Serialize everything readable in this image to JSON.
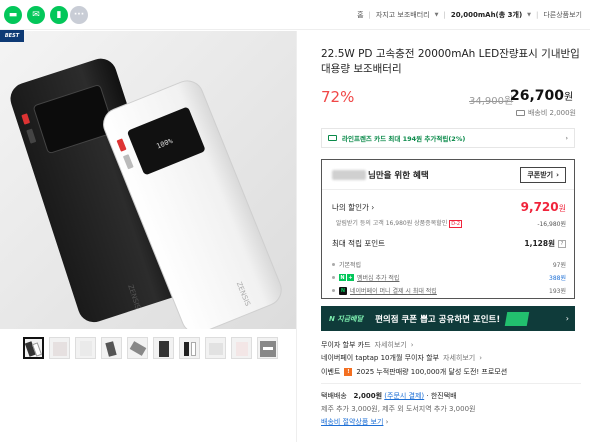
{
  "topbar": {
    "share_icons": [
      "talk-talk-icon",
      "talk-icon",
      "bookmark-icon",
      "more-icon"
    ],
    "crumbs": {
      "home": "홈",
      "category": "자지고 보조배터리",
      "option": "20,000mAh(총 3개)",
      "more": "다른상품보기"
    }
  },
  "image": {
    "badge": "BEST",
    "thumb_count": 10
  },
  "product": {
    "title": "22.5W PD 고속충전 20000mAh LED잔량표시 기내반입 대용량 보조배터리",
    "discount": "72%",
    "original_price": "34,900원",
    "price_number": "26,700",
    "price_unit": "원",
    "shipping": "배송비 2,000원"
  },
  "card_promo": "라인프렌즈 카드 최대 194원 추가적립(2%)",
  "benefit": {
    "title": "님만을 위한 혜택",
    "coupon_button": "쿠폰받기",
    "my_price_label": "나의 할인가",
    "my_price_number": "9,720",
    "my_price_unit": "원",
    "sub_text": "알림받기 등의 고객 16,980원 상품증복할인",
    "sub_tag": "D-2",
    "sub_value": "-16,980원",
    "points_label": "최대 적립 포인트",
    "points_value": "1,128원",
    "points_help": "?",
    "items": [
      {
        "label": "기본적립",
        "value": "97원",
        "badge": "",
        "link": false,
        "blue": false
      },
      {
        "label": "멤버십 추가 적립",
        "value": "388원",
        "badge": "N+",
        "link": true,
        "blue": true
      },
      {
        "label": "네이버페이 머니 결제 시 최대 적립",
        "value": "193원",
        "badge": "N",
        "link": true,
        "blue": false
      }
    ]
  },
  "banner": {
    "logo": "N 지금배달",
    "text": "편의점 쿠폰 뽑고 공유하면 포인트!"
  },
  "payment": {
    "row1_label": "무이자 할부 카드",
    "row1_link": "자세히보기",
    "row2_label": "네이버페이 taptap 10개월 무이자 할부",
    "row2_link": "자세히보기",
    "event_label": "이벤트",
    "event_text": "2025 누적판매량 100,000개 달성 도전! 프로모션"
  },
  "delivery": {
    "label": "택배배송",
    "fee": "2,000원",
    "fee_note": "(주문시 결제)",
    "carrier": "· 한진택배",
    "extra": "제주 추가 3,000원, 제주 외 도서지역 추가 3,000원",
    "bundle_link": "배송비 절약상품 보기"
  }
}
